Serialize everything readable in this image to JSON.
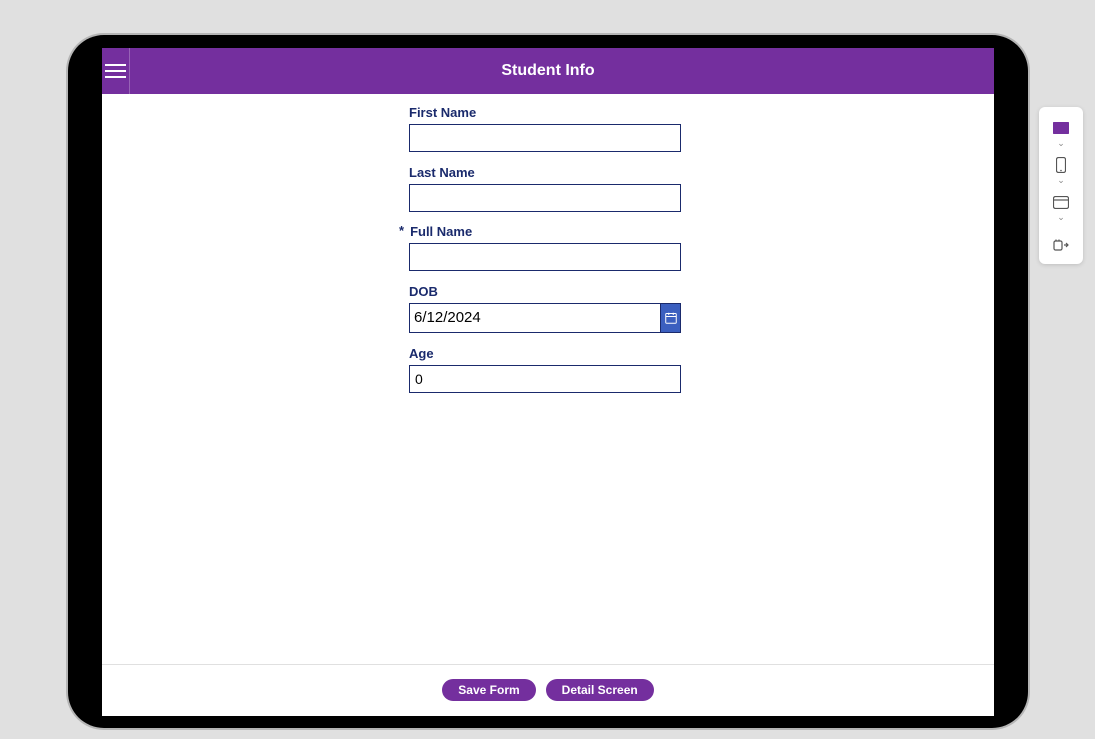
{
  "header": {
    "title": "Student Info"
  },
  "form": {
    "fields": {
      "firstName": {
        "label": "First Name",
        "value": "",
        "required": false
      },
      "lastName": {
        "label": "Last Name",
        "value": "",
        "required": false
      },
      "fullName": {
        "label": "Full Name",
        "value": "",
        "required": true,
        "required_marker": "*"
      },
      "dob": {
        "label": "DOB",
        "value": "6/12/2024"
      },
      "age": {
        "label": "Age",
        "value": "0"
      }
    }
  },
  "footer": {
    "saveLabel": "Save Form",
    "detailLabel": "Detail Screen"
  },
  "sidePanel": {
    "items": [
      {
        "name": "tablet",
        "active": true
      },
      {
        "name": "phone",
        "active": false
      },
      {
        "name": "browser",
        "active": false
      },
      {
        "name": "export",
        "active": false
      }
    ]
  },
  "colors": {
    "accent": "#742f9e",
    "border": "#1a2a6c",
    "bg": "#e0e0e0"
  }
}
